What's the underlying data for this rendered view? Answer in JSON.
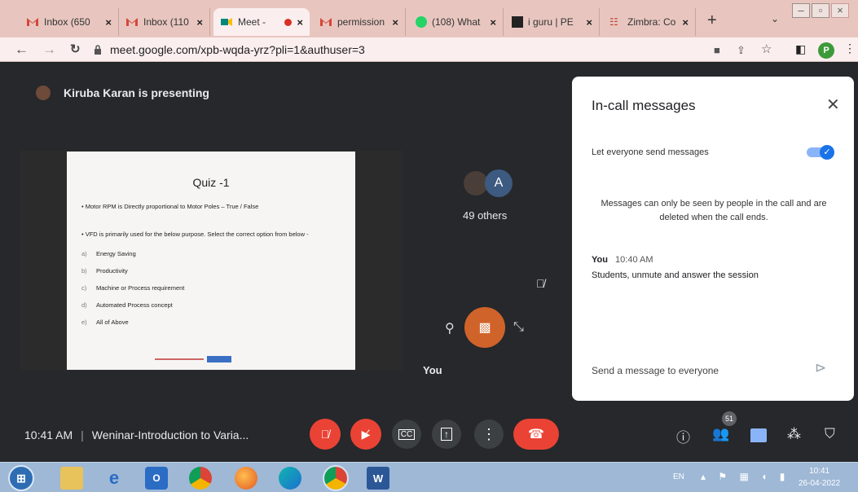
{
  "browser": {
    "tabs": [
      {
        "title": "Inbox (650",
        "icon": "gmail-icon"
      },
      {
        "title": "Inbox (110",
        "icon": "gmail-icon"
      },
      {
        "title": "Meet -",
        "icon": "meet-icon",
        "active": true
      },
      {
        "title": "permission",
        "icon": "gmail-icon"
      },
      {
        "title": "(108) What",
        "icon": "whatsapp-icon"
      },
      {
        "title": "i guru | PE",
        "icon": "iguru-icon"
      },
      {
        "title": "Zimbra: Co",
        "icon": "zimbra-icon"
      }
    ],
    "new_tab": "+",
    "url": "meet.google.com/xpb-wqda-yrz?pli=1&authuser=3",
    "profile_initial": "P"
  },
  "meet": {
    "presenter_label": "Kiruba Karan is presenting",
    "others": {
      "avatar_letter": "A",
      "label": "49 others"
    },
    "you_label": "You",
    "slide": {
      "title": "Quiz -1",
      "q1": "•  Motor RPM is Directly proportional to Motor Poles – True / False",
      "q2": "•  VFD is primarily used for the below purpose. Select the correct option from below -",
      "options": [
        {
          "letter": "a)",
          "text": "Energy Saving"
        },
        {
          "letter": "b)",
          "text": "Productivity"
        },
        {
          "letter": "c)",
          "text": "Machine or Process requirement"
        },
        {
          "letter": "d)",
          "text": "Automated Process concept"
        },
        {
          "letter": "e)",
          "text": "All of Above"
        }
      ]
    },
    "panel": {
      "title": "In-call messages",
      "toggle_label": "Let everyone send messages",
      "toggle_on": true,
      "notice": "Messages can only be seen by people in the call and are deleted when the call ends.",
      "message": {
        "sender": "You",
        "time": "10:40 AM",
        "text": "Students, unmute and answer the session"
      },
      "input_placeholder": "Send a message to everyone"
    },
    "bottom": {
      "time": "10:41 AM",
      "separator": "|",
      "meeting_title": "Weninar-Introduction to Varia...",
      "participants_count": "51"
    }
  },
  "taskbar": {
    "lang": "EN",
    "time": "10:41",
    "date": "26-04-2022"
  },
  "colors": {
    "meet_bg": "#26282b",
    "red": "#ea4335",
    "accent_blue": "#1a73e8",
    "avatar_orange": "#d0632a"
  }
}
